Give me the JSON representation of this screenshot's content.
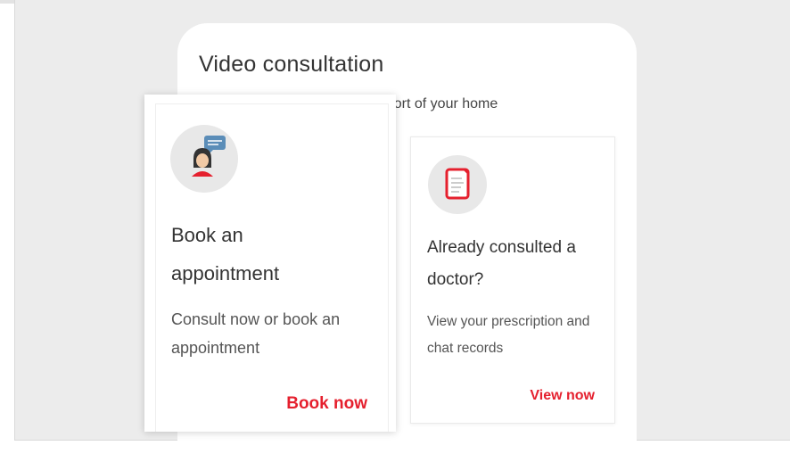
{
  "panel": {
    "title": "Video consultation",
    "subtitle": "Consult a doctor from the comfort of your home"
  },
  "cards": [
    {
      "icon": "doctor-chat-icon",
      "title": "Book an appointment",
      "description": "Consult now or book an appointment",
      "action": "Book now"
    },
    {
      "icon": "prescription-icon",
      "title": "Already consulted a doctor?",
      "description": "View your prescription and chat records",
      "action": "View now"
    }
  ],
  "colors": {
    "accent": "#e5202e",
    "background": "#ececec",
    "card": "#ffffff",
    "icon_background": "#e8e8e8"
  }
}
